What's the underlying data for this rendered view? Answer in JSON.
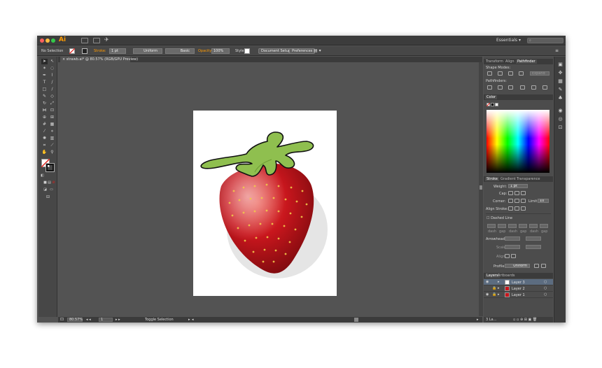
{
  "window": {
    "app_icon": "Ai",
    "workspace": "Essentials",
    "workspace_chevron": "▾"
  },
  "control_bar": {
    "selection": "No Selection",
    "stroke_label": "Stroke:",
    "stroke_weight": "1 pt",
    "profile": "Uniform",
    "brush": "Basic",
    "opacity_label": "Opacity:",
    "opacity_value": "100%",
    "style_label": "Style:",
    "document_setup": "Document Setup",
    "preferences": "Preferences"
  },
  "document": {
    "tab_title": "strawb.ai* @ 80.57% (RGB/GPU Preview)",
    "close_glyph": "×"
  },
  "status_bar": {
    "zoom": "80.57%",
    "artboard_index": "1",
    "tool_status": "Toggle Selection"
  },
  "transform_panel": {
    "tabs": [
      "Transform",
      "Align",
      "Pathfinder"
    ],
    "active_tab": "Pathfinder",
    "shape_modes_label": "Shape Modes:",
    "expand_label": "Expand",
    "pathfinders_label": "Pathfinders:"
  },
  "color_panel": {
    "tab": "Color"
  },
  "stroke_panel": {
    "tabs": [
      "Stroke",
      "Gradient",
      "Transparence"
    ],
    "weight_label": "Weight:",
    "weight_value": "1 pt",
    "cap_label": "Cap:",
    "corner_label": "Corner:",
    "limit_label": "Limit:",
    "limit_value": "10",
    "align_label": "Align Stroke:",
    "dashed_label": "Dashed Line",
    "dash_labels": [
      "dash",
      "gap",
      "dash",
      "gap",
      "dash",
      "gap"
    ],
    "arrowheads_label": "Arrowheads:",
    "scale_label": "Scale:",
    "align_arrow_label": "Align:",
    "profile_label": "Profile:",
    "profile_value": "Uniform"
  },
  "layers_panel": {
    "tabs": [
      "Layers",
      "Artboards"
    ],
    "layers": [
      {
        "name": "Layer 3",
        "selected": true
      },
      {
        "name": "Layer 2",
        "selected": false
      },
      {
        "name": "Layer 1",
        "selected": false
      }
    ],
    "count_label": "3 La..."
  },
  "colors": {
    "accent": "#ff9a00",
    "close": "#fc605c",
    "minimize": "#fdbc40",
    "zoom": "#34c84a",
    "berry": "#c8161d",
    "leaf": "#8fbf4f"
  }
}
